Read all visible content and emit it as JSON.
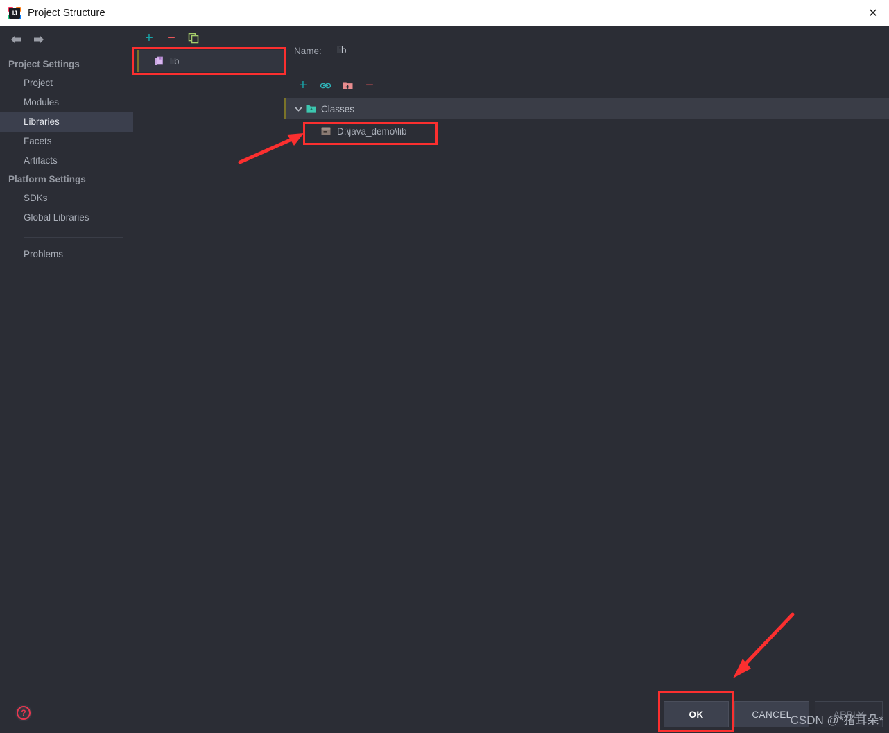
{
  "window": {
    "title": "Project Structure",
    "app_icon": "intellij-idea-icon",
    "icon_text": "IJ",
    "close_label": "✕"
  },
  "nav": {
    "back_icon": "⬅",
    "forward_icon": "➡"
  },
  "sidebar": {
    "groups": [
      {
        "title": "Project Settings",
        "items": [
          {
            "label": "Project",
            "selected": false
          },
          {
            "label": "Modules",
            "selected": false
          },
          {
            "label": "Libraries",
            "selected": true
          },
          {
            "label": "Facets",
            "selected": false
          },
          {
            "label": "Artifacts",
            "selected": false
          }
        ]
      },
      {
        "title": "Platform Settings",
        "items": [
          {
            "label": "SDKs",
            "selected": false
          },
          {
            "label": "Global Libraries",
            "selected": false
          }
        ]
      }
    ],
    "problems_label": "Problems"
  },
  "library_list": {
    "toolbar": [
      {
        "name": "add-library-button",
        "glyph": "+",
        "color": "#18a4a8"
      },
      {
        "name": "remove-library-button",
        "glyph": "−",
        "color": "#e8575a"
      },
      {
        "name": "copy-library-button",
        "glyph": "copy-icon",
        "color": "#a5cc6a"
      }
    ],
    "items": [
      {
        "label": "lib",
        "icon": "library-icon",
        "selected": true
      }
    ]
  },
  "detail": {
    "name_label_pre": "Na",
    "name_label_mnemonic": "m",
    "name_label_post": "e:",
    "name_value": "lib",
    "name_placeholder": "",
    "toolbar": [
      {
        "name": "add-classes-button",
        "glyph": "+",
        "color": "#18a4a8"
      },
      {
        "name": "attach-url-button",
        "glyph": "link-icon",
        "color": "#2fb0b5"
      },
      {
        "name": "attach-directory-button",
        "glyph": "folder-add-icon",
        "color": "#e87e80"
      },
      {
        "name": "remove-item-button",
        "glyph": "−",
        "color": "#e8575a"
      }
    ],
    "tree": {
      "root_label": "Classes",
      "root_icon": "folder-classes-icon",
      "expand_icon": "chevron-down-icon",
      "children": [
        {
          "label": "D:\\java_demo\\lib",
          "icon": "archive-icon"
        }
      ]
    }
  },
  "buttons": {
    "ok": "OK",
    "cancel": "CANCEL",
    "apply": "APPLY",
    "help": "?"
  },
  "watermark": "CSDN @*猪耳朵*",
  "colors": {
    "background": "#2b2d35",
    "titlebar": "#ffffff",
    "selection": "#3b3f4d",
    "annotation_red": "#fb2f2f",
    "accent_cyan": "#18a4a8",
    "accent_red": "#e8575a"
  }
}
